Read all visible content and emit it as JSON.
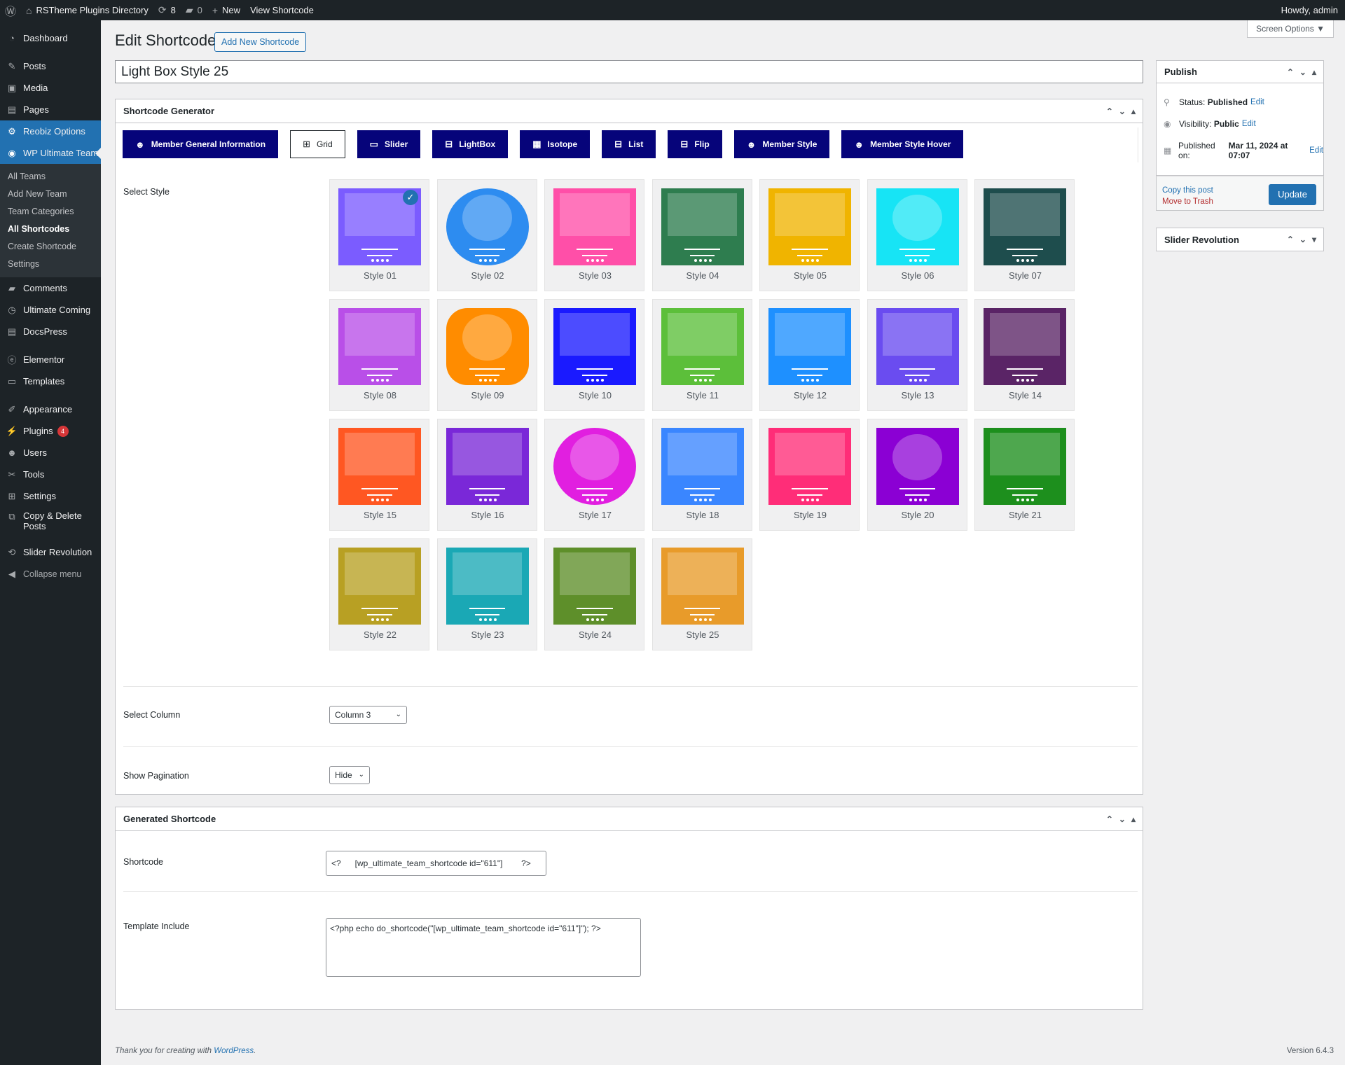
{
  "adminbar": {
    "site_name": "RSTheme Plugins Directory",
    "updates": "8",
    "comments": "0",
    "new_label": "New",
    "view_label": "View Shortcode",
    "howdy": "Howdy, admin"
  },
  "menu": {
    "dashboard": "Dashboard",
    "posts": "Posts",
    "media": "Media",
    "pages": "Pages",
    "reobiz": "Reobiz Options",
    "wput": "WP Ultimate Team",
    "sub": [
      "All Teams",
      "Add New Team",
      "Team Categories",
      "All Shortcodes",
      "Create Shortcode",
      "Settings"
    ],
    "comments": "Comments",
    "ultimate_coming": "Ultimate Coming",
    "docspress": "DocsPress",
    "elementor": "Elementor",
    "templates": "Templates",
    "appearance": "Appearance",
    "plugins": "Plugins",
    "plugins_badge": "4",
    "users": "Users",
    "tools": "Tools",
    "settings": "Settings",
    "copy_delete_1": "Copy & Delete",
    "copy_delete_2": "Posts",
    "slider_revolution": "Slider Revolution",
    "collapse": "Collapse menu"
  },
  "page": {
    "title": "Edit Shortcode",
    "add_new": "Add New Shortcode",
    "screen_options": "Screen Options ▼",
    "post_title": "Light Box Style 25"
  },
  "generator": {
    "heading": "Shortcode Generator",
    "tabs": [
      "Member General Information",
      "Grid",
      "Slider",
      "LightBox",
      "Isotope",
      "List",
      "Flip",
      "Member Style",
      "Member Style Hover"
    ],
    "select_style_label": "Select Style",
    "styles": [
      "Style 01",
      "Style 02",
      "Style 03",
      "Style 04",
      "Style 05",
      "Style 06",
      "Style 07",
      "Style 08",
      "Style 09",
      "Style 10",
      "Style 11",
      "Style 12",
      "Style 13",
      "Style 14",
      "Style 15",
      "Style 16",
      "Style 17",
      "Style 18",
      "Style 19",
      "Style 20",
      "Style 21",
      "Style 22",
      "Style 23",
      "Style 24",
      "Style 25"
    ],
    "style_colors": [
      "#7b5cff",
      "#2d8cf0",
      "#ff4fa8",
      "#2e7d4f",
      "#f0b400",
      "#17e4f5",
      "#1e4d4d",
      "#b94fe8",
      "#ff8c00",
      "#1a1aff",
      "#5cbf3a",
      "#1e90ff",
      "#6a4cf0",
      "#5a2466",
      "#ff5722",
      "#7a28d8",
      "#e11fe0",
      "#3a86ff",
      "#ff2d78",
      "#8b00d4",
      "#1d8f1d",
      "#b8a023",
      "#1aa8b5",
      "#5e8f2a",
      "#e89b2a"
    ],
    "column_label": "Select Column",
    "column_value": "Column 3",
    "pagination_label": "Show Pagination",
    "pagination_value": "Hide"
  },
  "generated": {
    "heading": "Generated Shortcode",
    "shortcode_label": "Shortcode",
    "shortcode_value": "<?      [wp_ultimate_team_shortcode id=\"611\"]        ?>",
    "template_label": "Template Include",
    "template_value": "<?php echo do_shortcode(\"[wp_ultimate_team_shortcode id=\"611\"]\"); ?>"
  },
  "publish": {
    "heading": "Publish",
    "status_label": "Status:",
    "status_value": "Published",
    "visibility_label": "Visibility:",
    "visibility_value": "Public",
    "published_label": "Published on:",
    "published_value": "Mar 11, 2024 at 07:07",
    "edit": "Edit",
    "copy": "Copy this post",
    "trash": "Move to Trash",
    "update": "Update"
  },
  "slider_box": {
    "heading": "Slider Revolution"
  },
  "footer": {
    "thanks": "Thank you for creating with",
    "wp": "WordPress",
    "dot": ".",
    "version": "Version 6.4.3"
  }
}
